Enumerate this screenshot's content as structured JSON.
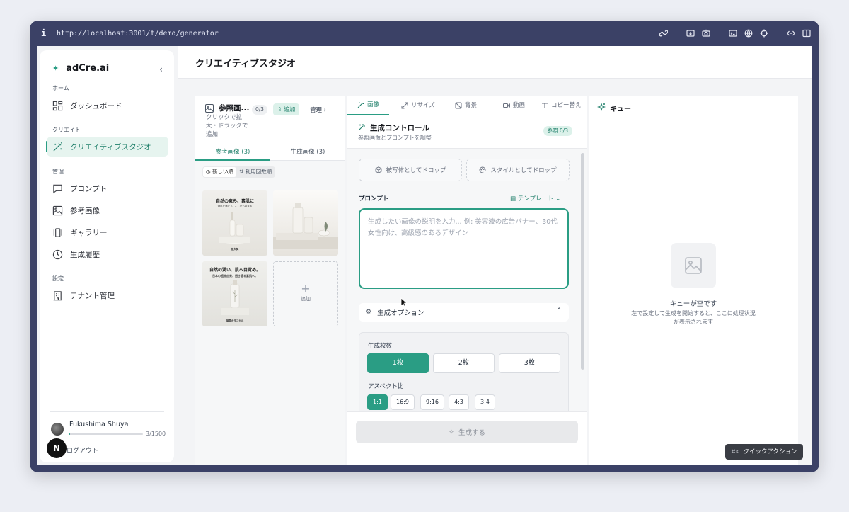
{
  "browser": {
    "info": "i",
    "url": "http://localhost:3001/t/demo/generator"
  },
  "sidebar": {
    "brand": "adCre.ai",
    "collapse": "‹",
    "sections": {
      "home": "ホーム",
      "create": "クリエイト",
      "manage": "管理",
      "settings": "設定"
    },
    "items": [
      {
        "label": "ダッシュボード",
        "icon": "dashboard-icon"
      },
      {
        "label": "クリエイティブスタジオ",
        "icon": "magic-wand-icon",
        "active": true
      },
      {
        "label": "プロンプト",
        "icon": "message-icon"
      },
      {
        "label": "参考画像",
        "icon": "image-icon"
      },
      {
        "label": "ギャラリー",
        "icon": "gallery-icon"
      },
      {
        "label": "生成履歴",
        "icon": "clock-icon"
      },
      {
        "label": "テナント管理",
        "icon": "building-icon"
      }
    ],
    "user": {
      "name": "Fukushima Shuya",
      "usage": "3/1500",
      "usage_fraction": 0.002
    },
    "logout": "ログアウト",
    "badge": "N"
  },
  "header": {
    "title": "クリエイティブスタジオ"
  },
  "references": {
    "title": "参照画...",
    "hint": "クリックで拡大・ドラッグで追加",
    "count": "0/3",
    "add": "追加",
    "manage": "管理 ›",
    "tabs": [
      "参考画像 (3)",
      "生成画像 (3)"
    ],
    "sort": [
      "新しい順",
      "利用回数順"
    ],
    "thumbs": [
      {
        "headline": "自然の恵み、素肌に",
        "sub": "潤肌を満たす、ここから始まる",
        "brand": "悠久美"
      },
      {
        "headline": "",
        "sub": "",
        "brand": ""
      },
      {
        "headline": "自然の潤い、肌へ目覚め。",
        "sub": "日本の植物由来、透き通る素肌へ。",
        "brand": "瑞美ボタニカル"
      }
    ],
    "add_tile": "追加"
  },
  "generator": {
    "tabs": [
      "画像",
      "リサイズ",
      "背景",
      "動画",
      "コピー替え"
    ],
    "title": "生成コントロール",
    "subtitle": "参照画像とプロンプトを調整",
    "ref_badge": "参照 0/3",
    "drop_subject": "被写体としてドロップ",
    "drop_style": "スタイルとしてドロップ",
    "prompt_label": "プロンプト",
    "template": "テンプレート ⌄",
    "prompt_value": "",
    "prompt_placeholder": "生成したい画像の説明を入力... 例: 美容液の広告バナー、30代女性向け、高級感のあるデザイン",
    "options_label": "生成オプション",
    "options_chevron": "⌃",
    "count_label": "生成枚数",
    "counts": [
      "1枚",
      "2枚",
      "3枚"
    ],
    "aspect_label": "アスペクト比",
    "aspects": [
      "1:1",
      "16:9",
      "9:16",
      "4:3",
      "3:4"
    ],
    "generate": "生成する"
  },
  "queue": {
    "title": "キュー",
    "empty_title": "キューが空です",
    "empty_sub": "左で設定して生成を開始すると、ここに処理状況が表示されます"
  },
  "quick_action": {
    "key": "⌘K",
    "label": "クイックアクション"
  },
  "colors": {
    "accent": "#2a9d84",
    "accent_light": "#dcf1ea",
    "frame": "#3b4166"
  }
}
